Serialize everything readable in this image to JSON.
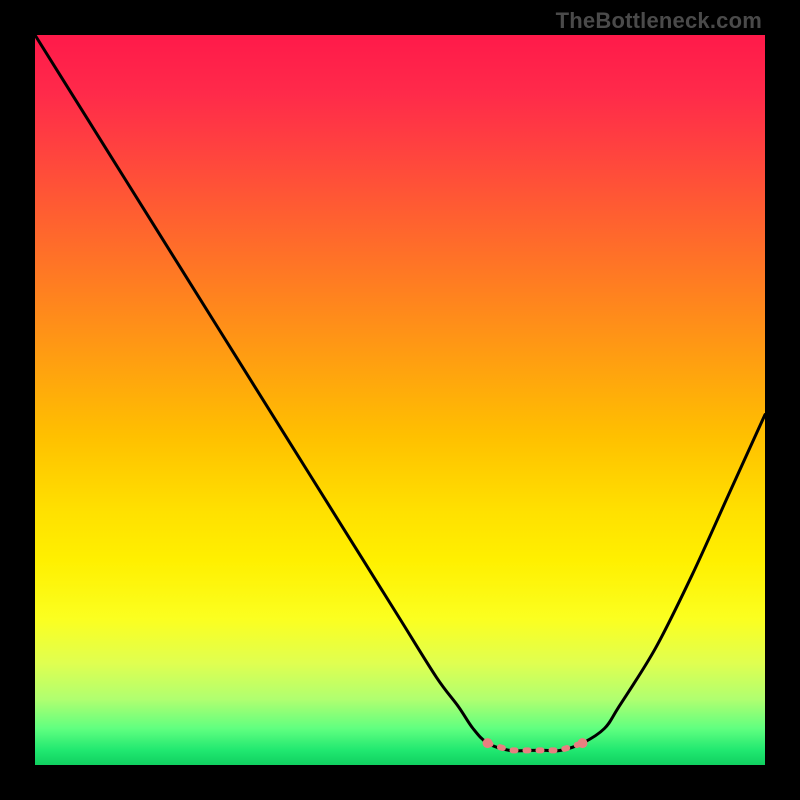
{
  "watermark": "TheBottleneck.com",
  "chart_data": {
    "type": "line",
    "title": "",
    "xlabel": "",
    "ylabel": "",
    "xlim": [
      0,
      100
    ],
    "ylim": [
      0,
      100
    ],
    "grid": false,
    "legend": false,
    "series": [
      {
        "name": "bottleneck-curve",
        "color": "#000000",
        "x": [
          0,
          5,
          10,
          15,
          20,
          25,
          30,
          35,
          40,
          45,
          50,
          55,
          58,
          60,
          62,
          65,
          68,
          70,
          72,
          75,
          78,
          80,
          85,
          90,
          95,
          100
        ],
        "values": [
          100,
          92,
          84,
          76,
          68,
          60,
          52,
          44,
          36,
          28,
          20,
          12,
          8,
          5,
          3,
          2,
          2,
          2,
          2,
          3,
          5,
          8,
          16,
          26,
          37,
          48
        ]
      }
    ],
    "flat_region": {
      "x_start": 62,
      "x_end": 75,
      "marker_color": "#e88080",
      "marker_radius_px": 5,
      "dash_color": "#e88080"
    },
    "background_gradient": {
      "stops": [
        {
          "pos": 0.0,
          "color": "#ff1a4a"
        },
        {
          "pos": 0.5,
          "color": "#ffc000"
        },
        {
          "pos": 0.8,
          "color": "#fbff20"
        },
        {
          "pos": 1.0,
          "color": "#10d060"
        }
      ]
    }
  }
}
